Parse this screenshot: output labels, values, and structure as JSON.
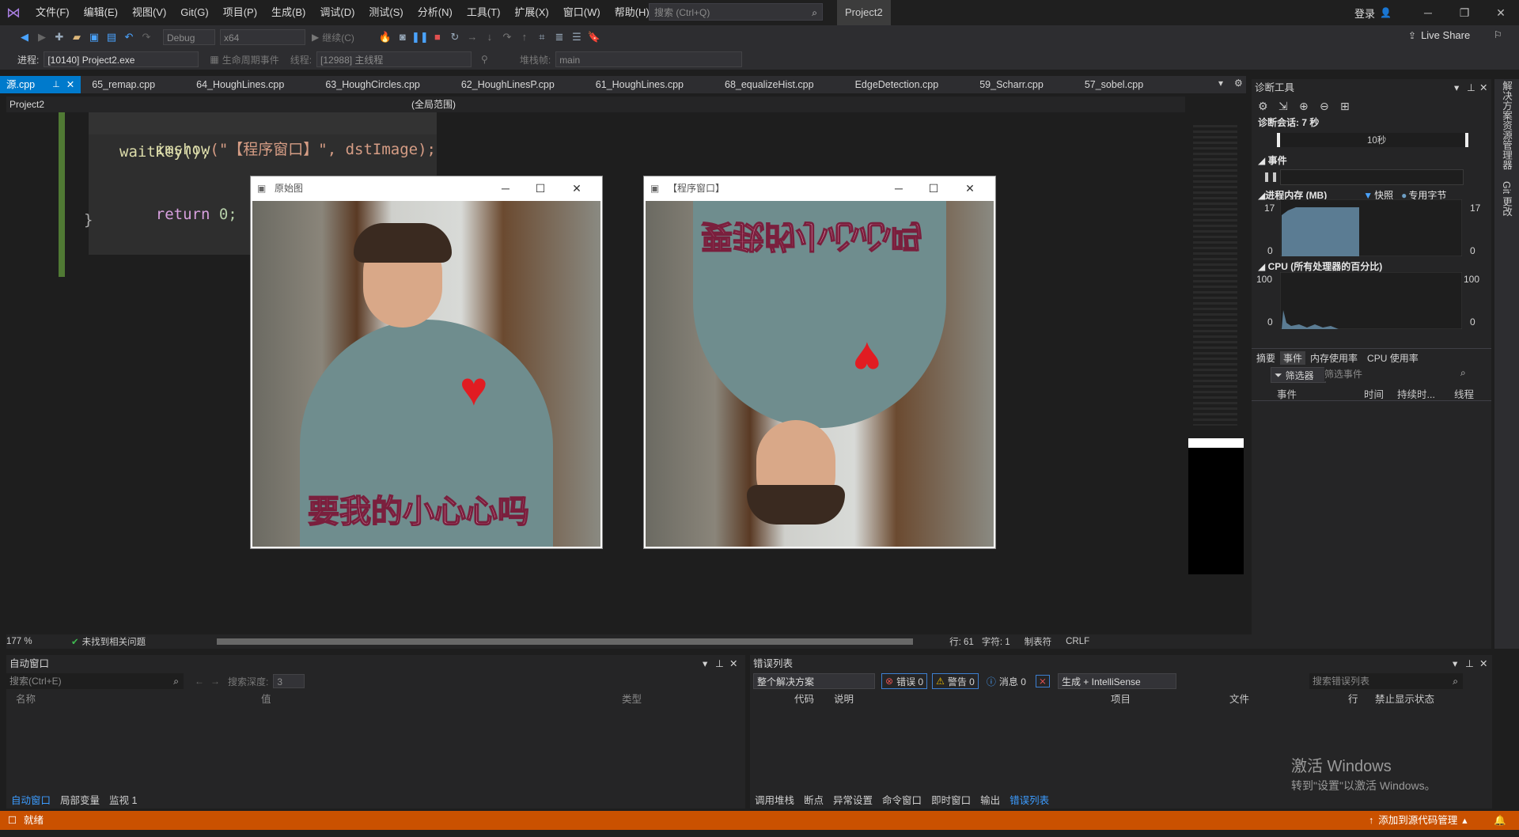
{
  "app": {
    "menu": [
      "文件(F)",
      "编辑(E)",
      "视图(V)",
      "Git(G)",
      "项目(P)",
      "生成(B)",
      "调试(D)",
      "测试(S)",
      "分析(N)",
      "工具(T)",
      "扩展(X)",
      "窗口(W)",
      "帮助(H)"
    ],
    "search_placeholder": "搜索 (Ctrl+Q)",
    "project_title": "Project2",
    "login": "登录",
    "live_share": "Live Share"
  },
  "toolbar": {
    "config": "Debug",
    "platform": "x64",
    "continue": "继续(C)",
    "process_label": "进程:",
    "process_value": "[10140] Project2.exe",
    "lifecycle": "生命周期事件",
    "thread_label": "线程:",
    "thread_value": "[12988] 主线程",
    "stackframe_label": "堆栈帧:",
    "stackframe_value": "main"
  },
  "tabs": [
    "源.cpp",
    "65_remap.cpp",
    "64_HoughLines.cpp",
    "63_HoughCircles.cpp",
    "62_HoughLinesP.cpp",
    "61_HoughLines.cpp",
    "68_equalizeHist.cpp",
    "EdgeDetection.cpp",
    "59_Scharr.cpp",
    "57_sobel.cpp"
  ],
  "navbar": {
    "project": "Project2",
    "scope": "(全局范围)"
  },
  "code": {
    "line1_fn": "imshow",
    "line1_args": "(\"【程序窗口】\", dstImage);",
    "line2": "waitKey();",
    "line3_kw": "return",
    "line3_rest": " 0;",
    "line4": "}"
  },
  "windows": [
    {
      "title": "原始图",
      "caption_text": "要我的小心心吗"
    },
    {
      "title": "【程序窗口】",
      "caption_text": "要我的小心心吗"
    }
  ],
  "editor_status": {
    "zoom": "177 %",
    "issues": "未找到相关问题",
    "line": "行: 61",
    "char": "字符: 1",
    "tabs": "制表符",
    "eol": "CRLF"
  },
  "diagnostics": {
    "title": "诊断工具",
    "session": "诊断会话: 7 秒",
    "timeline": "10秒",
    "events": "事件",
    "memory": "进程内存 (MB)",
    "snapshot": "快照",
    "private_bytes": "专用字节",
    "mem_max": "17",
    "mem_min": "0",
    "cpu": "CPU (所有处理器的百分比)",
    "cpu_max": "100",
    "cpu_min": "0",
    "tabs": [
      "摘要",
      "事件",
      "内存使用率",
      "CPU 使用率"
    ],
    "filter": "筛选器",
    "filter_placeholder": "筛选事件",
    "columns": [
      "事件",
      "时间",
      "持续时...",
      "线程"
    ],
    "side_tabs": [
      "解决方案资源管理器",
      "Git 更改"
    ]
  },
  "autos": {
    "title": "自动窗口",
    "search_placeholder": "搜索(Ctrl+E)",
    "depth_label": "搜索深度:",
    "depth_value": "3",
    "columns": [
      "名称",
      "值",
      "类型"
    ],
    "tabs": [
      "自动窗口",
      "局部变量",
      "监视 1"
    ]
  },
  "errors": {
    "title": "错误列表",
    "scope": "整个解决方案",
    "errors": "错误 0",
    "warnings": "警告 0",
    "messages": "消息 0",
    "build": "生成 + IntelliSense",
    "search_placeholder": "搜索错误列表",
    "columns": [
      "代码",
      "说明",
      "项目",
      "文件",
      "行",
      "禁止显示状态"
    ],
    "tabs": [
      "调用堆栈",
      "断点",
      "异常设置",
      "命令窗口",
      "即时窗口",
      "输出",
      "错误列表"
    ]
  },
  "watermark": {
    "line1": "激活 Windows",
    "line2": "转到\"设置\"以激活 Windows。"
  },
  "status": {
    "ready": "就绪",
    "source_control": "添加到源代码管理"
  },
  "colors": {
    "accent": "#007acc",
    "status": "#ca5100",
    "keyword": "#d8a0df",
    "string": "#d69d85",
    "number": "#b5cea8"
  }
}
